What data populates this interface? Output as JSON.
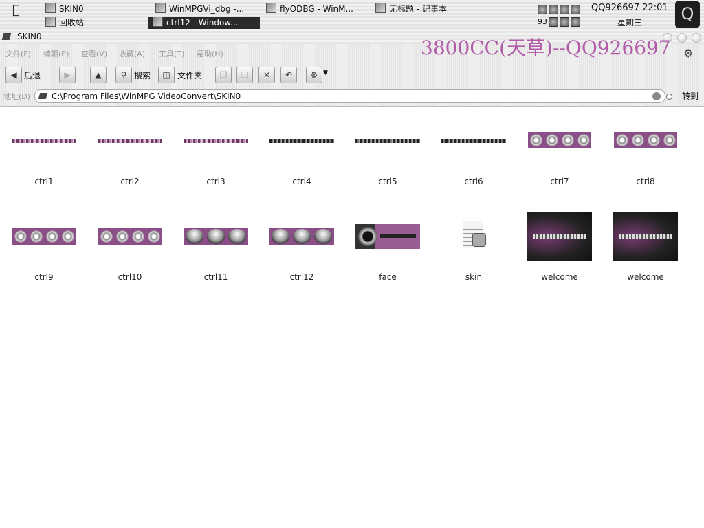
{
  "taskbar": {
    "pinned": [
      {
        "label": "SKIN0"
      },
      {
        "label": "回收站"
      }
    ],
    "tasks": [
      {
        "label": "WinMPGVi_dbg -..."
      },
      {
        "label": "ctrl12 - Window..."
      },
      {
        "label": "flyODBG - WinM..."
      },
      {
        "label": "无标题 - 记事本"
      }
    ],
    "tray_number": "93",
    "clock": {
      "user_time": "QQ926697 22:01",
      "weekday": "星期三"
    }
  },
  "window": {
    "title": "SKIN0",
    "watermark": "3800CC(天草)--QQ926697",
    "menu": [
      "文件(F)",
      "编辑(E)",
      "查看(V)",
      "收藏(A)",
      "工具(T)",
      "帮助(H)"
    ],
    "toolbar": {
      "back": "后退",
      "search": "搜索",
      "folders": "文件夹"
    },
    "address": {
      "label": "地址(D)",
      "value": "C:\\Program Files\\WinMPG VideoConvert\\SKIN0",
      "go": "转到"
    }
  },
  "files": [
    {
      "name": "ctrl1"
    },
    {
      "name": "ctrl2"
    },
    {
      "name": "ctrl3"
    },
    {
      "name": "ctrl4"
    },
    {
      "name": "ctrl5"
    },
    {
      "name": "ctrl6"
    },
    {
      "name": "ctrl7"
    },
    {
      "name": "ctrl8"
    },
    {
      "name": "ctrl9"
    },
    {
      "name": "ctrl10"
    },
    {
      "name": "ctrl11"
    },
    {
      "name": "ctrl12"
    },
    {
      "name": "face"
    },
    {
      "name": "skin"
    },
    {
      "name": "welcome"
    },
    {
      "name": "welcome"
    }
  ],
  "colors": {
    "watermark": "#b05aa8",
    "skin_purple": "#8a4f86"
  }
}
